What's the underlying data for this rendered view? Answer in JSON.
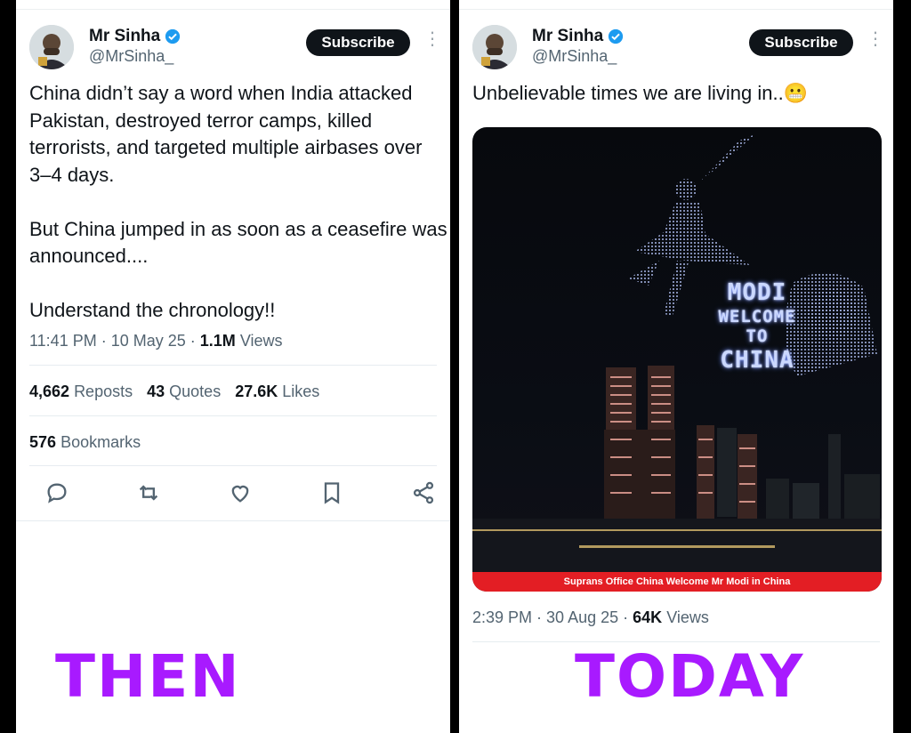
{
  "left_tweet": {
    "author_name": "Mr Sinha",
    "author_handle": "@MrSinha_",
    "subscribe_label": "Subscribe",
    "body": "China didn’t say a word when India attacked Pakistan, destroyed terror camps, killed terrorists, and targeted multiple airbases over 3–4 days.\n\nBut China jumped in as soon as a ceasefire was announced....\n\nUnderstand the chronology!!",
    "time": "11:41 PM",
    "date": "10 May 25",
    "views_count": "1.1M",
    "views_label": "Views",
    "reposts_count": "4,662",
    "reposts_label": "Reposts",
    "quotes_count": "43",
    "quotes_label": "Quotes",
    "likes_count": "27.6K",
    "likes_label": "Likes",
    "bookmarks_count": "576",
    "bookmarks_label": "Bookmarks",
    "caption": "THEN"
  },
  "right_tweet": {
    "author_name": "Mr Sinha",
    "author_handle": "@MrSinha_",
    "subscribe_label": "Subscribe",
    "body": "Unbelievable times we are living in..😬",
    "image_drone_text": [
      "MODI",
      "WELCOME",
      "TO",
      "CHINA"
    ],
    "image_caption": "Suprans Office China Welcome Mr Modi in China",
    "time": "2:39 PM",
    "date": "30 Aug 25",
    "views_count": "64K",
    "views_label": "Views",
    "caption": "TODAY"
  },
  "colors": {
    "caption": "#a81aff",
    "verified": "#1d9bf0",
    "image_banner": "#e31e24"
  },
  "icons": [
    "verified-badge-icon",
    "reply-icon",
    "repost-icon",
    "like-icon",
    "bookmark-icon",
    "share-icon",
    "more-icon"
  ]
}
